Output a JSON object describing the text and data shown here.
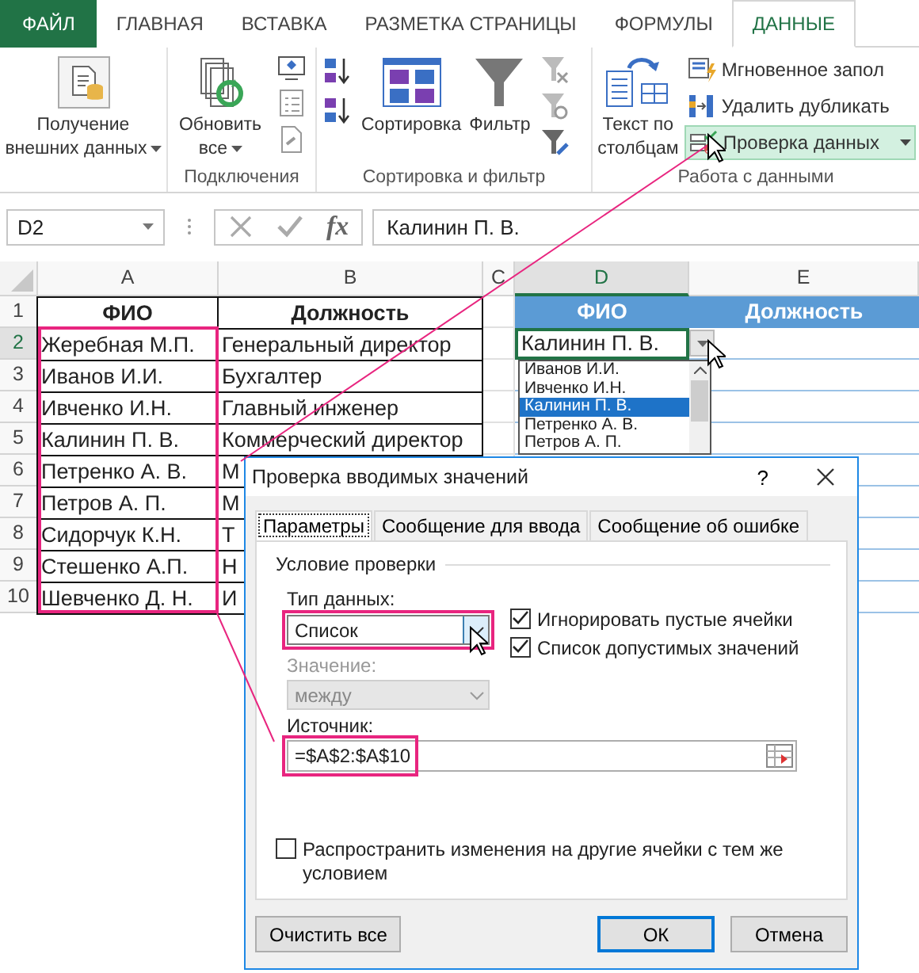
{
  "ribbon_tabs": [
    {
      "label": "ФАЙЛ",
      "kind": "file",
      "selected": false
    },
    {
      "label": "ГЛАВНАЯ",
      "kind": "tab",
      "selected": false
    },
    {
      "label": "ВСТАВКА",
      "kind": "tab",
      "selected": false
    },
    {
      "label": "РАЗМЕТКА СТРАНИЦЫ",
      "kind": "tab",
      "selected": false
    },
    {
      "label": "ФОРМУЛЫ",
      "kind": "tab",
      "selected": false
    },
    {
      "label": "ДАННЫЕ",
      "kind": "tab",
      "selected": true
    }
  ],
  "ribbon_groups": [
    {
      "buttons": [
        {
          "kind": "large",
          "label": "Получение внешних данных",
          "dropdown": true,
          "highlighted": false
        }
      ]
    },
    {
      "label": "Подключения",
      "buttons": [
        {
          "kind": "large",
          "label": "Обновить все",
          "dropdown": true,
          "highlighted": false
        }
      ]
    },
    {
      "label": "Сортировка и фильтр",
      "buttons": [
        {
          "kind": "large",
          "label": "Сортировка",
          "dropdown": false,
          "highlighted": false
        },
        {
          "kind": "large",
          "label": "Фильтр",
          "dropdown": false,
          "highlighted": false
        }
      ]
    },
    {
      "label": "Работа с данными",
      "buttons": [
        {
          "kind": "large",
          "label": "Текст по столбцам",
          "dropdown": false,
          "highlighted": false
        },
        {
          "kind": "small",
          "label": "Мгновенное запол",
          "dropdown": false,
          "highlighted": false
        },
        {
          "kind": "small",
          "label": "Удалить дубликать",
          "dropdown": false,
          "highlighted": false
        },
        {
          "kind": "small",
          "label": "Проверка данных",
          "dropdown": true,
          "highlighted": true
        }
      ]
    }
  ],
  "formula_bar": {
    "name_box": "D2",
    "fx": "fx",
    "value": "Калинин П. В."
  },
  "sheet": {
    "columns": [
      {
        "label": "A",
        "selected": false
      },
      {
        "label": "B",
        "selected": false
      },
      {
        "label": "C",
        "selected": false
      },
      {
        "label": "D",
        "selected": true
      },
      {
        "label": "E",
        "selected": false
      }
    ],
    "rows": [
      {
        "number": "1",
        "selected": false,
        "cells": {
          "A": "ФИО",
          "B": "Должность",
          "D": "ФИО",
          "E": "Должность"
        }
      },
      {
        "number": "2",
        "selected": true,
        "cells": {
          "A": "Жеребная М.П.",
          "B": "Генеральный директор",
          "D": "Калинин П. В."
        }
      },
      {
        "number": "3",
        "selected": false,
        "cells": {
          "A": "Иванов И.И.",
          "B": "Бухгалтер"
        }
      },
      {
        "number": "4",
        "selected": false,
        "cells": {
          "A": "Ивченко И.Н.",
          "B": "Главный инженер"
        }
      },
      {
        "number": "5",
        "selected": false,
        "cells": {
          "A": "Калинин П. В.",
          "B": "Коммерческий директор"
        }
      },
      {
        "number": "6",
        "selected": false,
        "cells": {
          "A": "Петренко А. В.",
          "B": "М"
        }
      },
      {
        "number": "7",
        "selected": false,
        "cells": {
          "A": "Петров А. П.",
          "B": "М"
        }
      },
      {
        "number": "8",
        "selected": false,
        "cells": {
          "A": "Сидорчук К.Н.",
          "B": "Т"
        }
      },
      {
        "number": "9",
        "selected": false,
        "cells": {
          "A": "Стешенко А.П.",
          "B": "Н"
        }
      },
      {
        "number": "10",
        "selected": false,
        "cells": {
          "A": "Шевченко Д. Н.",
          "B": "И"
        }
      }
    ]
  },
  "dropdown_list": {
    "items": [
      {
        "label": "Иванов И.И.",
        "selected": false
      },
      {
        "label": "Ивченко И.Н.",
        "selected": false
      },
      {
        "label": "Калинин П. В.",
        "selected": true
      },
      {
        "label": "Петренко А. В.",
        "selected": false
      },
      {
        "label": "Петров А. П.",
        "selected": false
      }
    ]
  },
  "dialog": {
    "title": "Проверка вводимых значений",
    "help": "?",
    "tabs": [
      {
        "label": "Параметры",
        "selected": true
      },
      {
        "label": "Сообщение для ввода",
        "selected": false
      },
      {
        "label": "Сообщение об ошибке",
        "selected": false
      }
    ],
    "group_title": "Условие проверки",
    "type_label": "Тип данных:",
    "type_value": "Список",
    "options": [
      {
        "label": "Игнорировать пустые ячейки",
        "checked": true
      },
      {
        "label": "Список допустимых значений",
        "checked": true
      }
    ],
    "value_label": "Значение:",
    "value_value": "между",
    "value_disabled": true,
    "source_label": "Источник:",
    "source_value": "=$A$2:$A$10",
    "apply_all": {
      "label": "Распространить изменения на другие ячейки с тем же условием",
      "checked": false
    },
    "buttons": [
      {
        "label": "Очистить все",
        "default": false
      },
      {
        "label": "ОК",
        "default": true
      },
      {
        "label": "Отмена",
        "default": false
      }
    ]
  }
}
